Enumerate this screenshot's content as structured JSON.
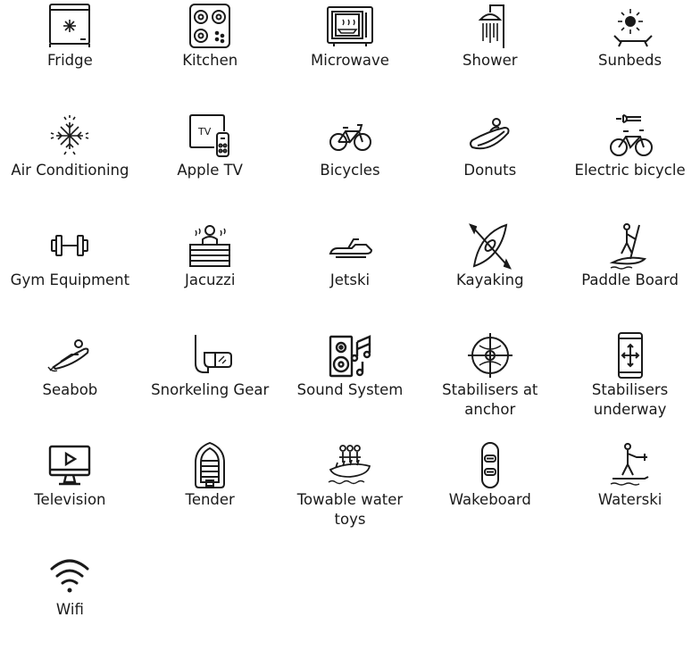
{
  "amenities": [
    {
      "label": "Fridge",
      "icon": "fridge-icon"
    },
    {
      "label": "Kitchen",
      "icon": "stove-icon"
    },
    {
      "label": "Microwave",
      "icon": "microwave-icon"
    },
    {
      "label": "Shower",
      "icon": "shower-icon"
    },
    {
      "label": "Sunbeds",
      "icon": "sunbed-icon"
    },
    {
      "label": "Air Conditioning",
      "icon": "snowflake-icon"
    },
    {
      "label": "Apple TV",
      "icon": "apple-tv-icon"
    },
    {
      "label": "Bicycles",
      "icon": "bicycle-icon"
    },
    {
      "label": "Donuts",
      "icon": "donut-tube-icon"
    },
    {
      "label": "Electric bicycle",
      "icon": "electric-bicycle-icon"
    },
    {
      "label": "Gym Equipment",
      "icon": "dumbbell-icon"
    },
    {
      "label": "Jacuzzi",
      "icon": "jacuzzi-icon"
    },
    {
      "label": "Jetski",
      "icon": "jetski-icon"
    },
    {
      "label": "Kayaking",
      "icon": "kayak-icon"
    },
    {
      "label": "Paddle Board",
      "icon": "paddle-board-icon"
    },
    {
      "label": "Seabob",
      "icon": "seabob-icon"
    },
    {
      "label": "Snorkeling Gear",
      "icon": "snorkel-icon"
    },
    {
      "label": "Sound System",
      "icon": "speaker-icon"
    },
    {
      "label": "Stabilisers at\nanchor",
      "icon": "stabiliser-anchor-icon"
    },
    {
      "label": "Stabilisers\nunderway",
      "icon": "stabiliser-underway-icon"
    },
    {
      "label": "Television",
      "icon": "television-icon"
    },
    {
      "label": "Tender",
      "icon": "tender-boat-icon"
    },
    {
      "label": "Towable water\ntoys",
      "icon": "towable-toy-icon"
    },
    {
      "label": "Wakeboard",
      "icon": "wakeboard-icon"
    },
    {
      "label": "Waterski",
      "icon": "waterski-icon"
    },
    {
      "label": "Wifi",
      "icon": "wifi-icon"
    }
  ]
}
